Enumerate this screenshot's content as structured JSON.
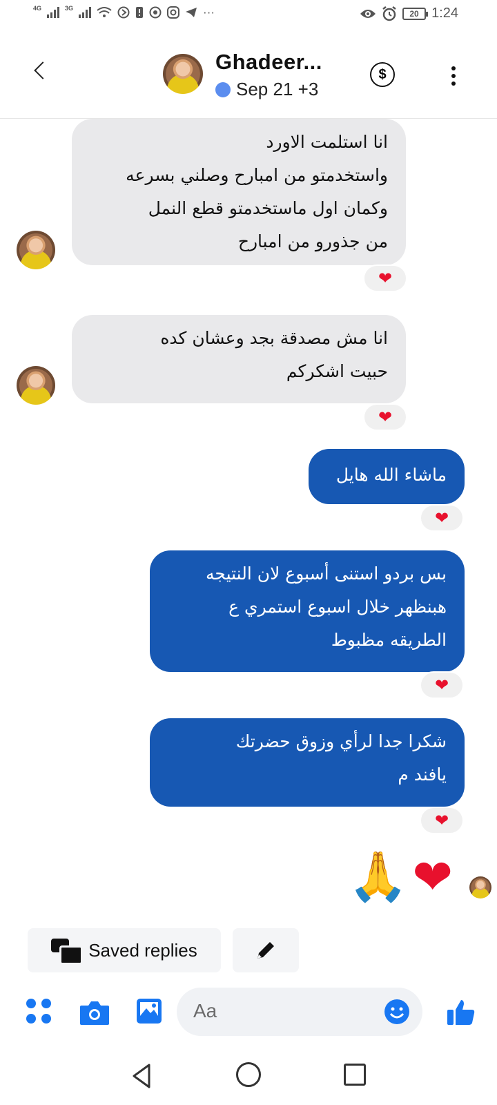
{
  "status_bar": {
    "net1": "4G",
    "net2": "3G",
    "battery": "20",
    "time": "1:24",
    "more": "···"
  },
  "header": {
    "name": "Ghadeer...",
    "subtitle": "Sep 21 +3",
    "status_color": "#5b8def"
  },
  "messages": [
    {
      "side": "in",
      "text": "انا استلمت الاورد\nواستخدمتو من امبارح وصلني بسرعه\nوكمان اول ماستخدمتو  قطع النمل\nمن جذورو من امبارح",
      "reaction": "❤"
    },
    {
      "side": "in",
      "text": "انا مش مصدقة بجد وعشان كده\nحبيت اشكركم",
      "reaction": "❤"
    },
    {
      "side": "out",
      "text": "ماشاء الله هايل",
      "reaction": "❤"
    },
    {
      "side": "out",
      "text": "بس بردو استنى أسبوع لان النتيجه\nهبنظهر خلال اسبوع استمري ع\nالطريقه مظبوط",
      "reaction": "❤"
    },
    {
      "side": "out",
      "text": "شكرا جدا لرأي وزوق حضرتك\nيافند م",
      "reaction": "❤"
    }
  ],
  "emoji_message": {
    "pray": "🙏",
    "heart": "❤"
  },
  "quick_actions": {
    "saved_replies": "Saved replies"
  },
  "composer": {
    "placeholder": "Aa"
  },
  "colors": {
    "outgoing_bubble": "#1758b3",
    "incoming_bubble": "#e9e9eb",
    "accent": "#1877f2",
    "reaction_heart": "#e8112d"
  }
}
